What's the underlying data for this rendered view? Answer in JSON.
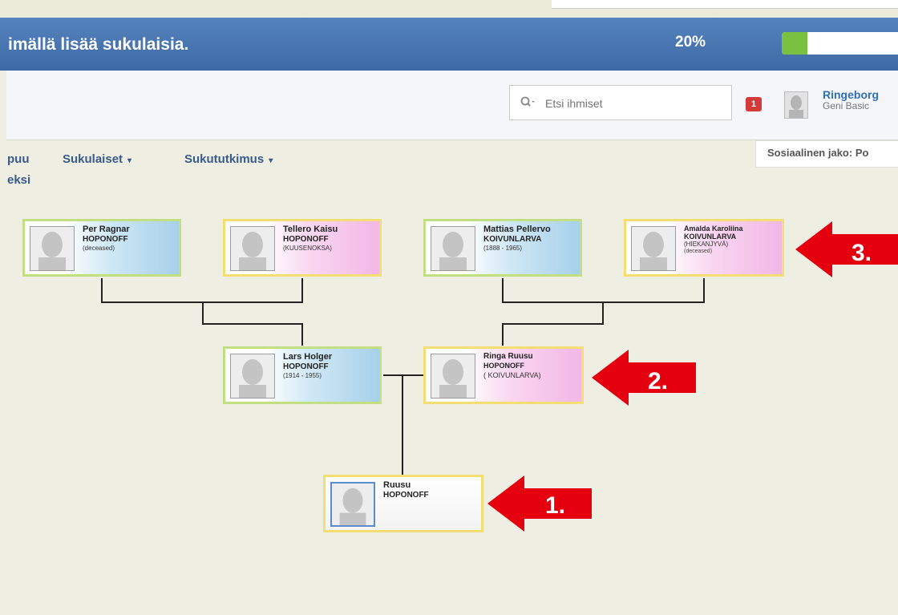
{
  "banner": {
    "text": "imällä lisää sukulaisia.",
    "percent": "20%",
    "progress_value": 0.2
  },
  "search": {
    "placeholder": "Etsi ihmiset"
  },
  "notifications": {
    "count": "1"
  },
  "user": {
    "name": "Ringeborg",
    "plan": "Geni Basic"
  },
  "nav": {
    "item1_line1": "puu",
    "item1_line2": "eksi",
    "relatives": "Sukulaiset",
    "genealogy": "Sukututkimus",
    "caret": "▾"
  },
  "social": {
    "label": "Sosiaalinen jako: Po"
  },
  "tree": {
    "per": {
      "first": "Per Ragnar",
      "last": "HOPONOFF",
      "extra": "(deceased)"
    },
    "tellero": {
      "first": "Tellero Kaisu",
      "last": "HOPONOFF",
      "extra": "(KUUSENOKSA)"
    },
    "mattias": {
      "first": "Mattias Pellervo",
      "last": "KOIVUNLARVA",
      "extra": "(1888 - 1965)"
    },
    "amalda": {
      "first": "Amalda Karoliina",
      "last": "KOIVUNLARVA",
      "extra": "(HIEKANJYVÄ)",
      "extra2": "(deceased)"
    },
    "lars": {
      "first": "Lars Holger",
      "last": "HOPONOFF",
      "extra": "(1914 - 1955)"
    },
    "ringa": {
      "first": "Ringa Ruusu",
      "last": "HOPONOFF",
      "extra": "( KOIVUNLARVA)"
    },
    "ruusu": {
      "first": "Ruusu",
      "last": "HOPONOFF"
    }
  },
  "arrows": {
    "a1": "1.",
    "a2": "2.",
    "a3": "3."
  },
  "colors": {
    "banner": "#4a77b2",
    "progress": "#7ac142",
    "male_card": "#a7d0ea",
    "female_card": "#f2b7e6",
    "arrow": "#e4000f"
  }
}
